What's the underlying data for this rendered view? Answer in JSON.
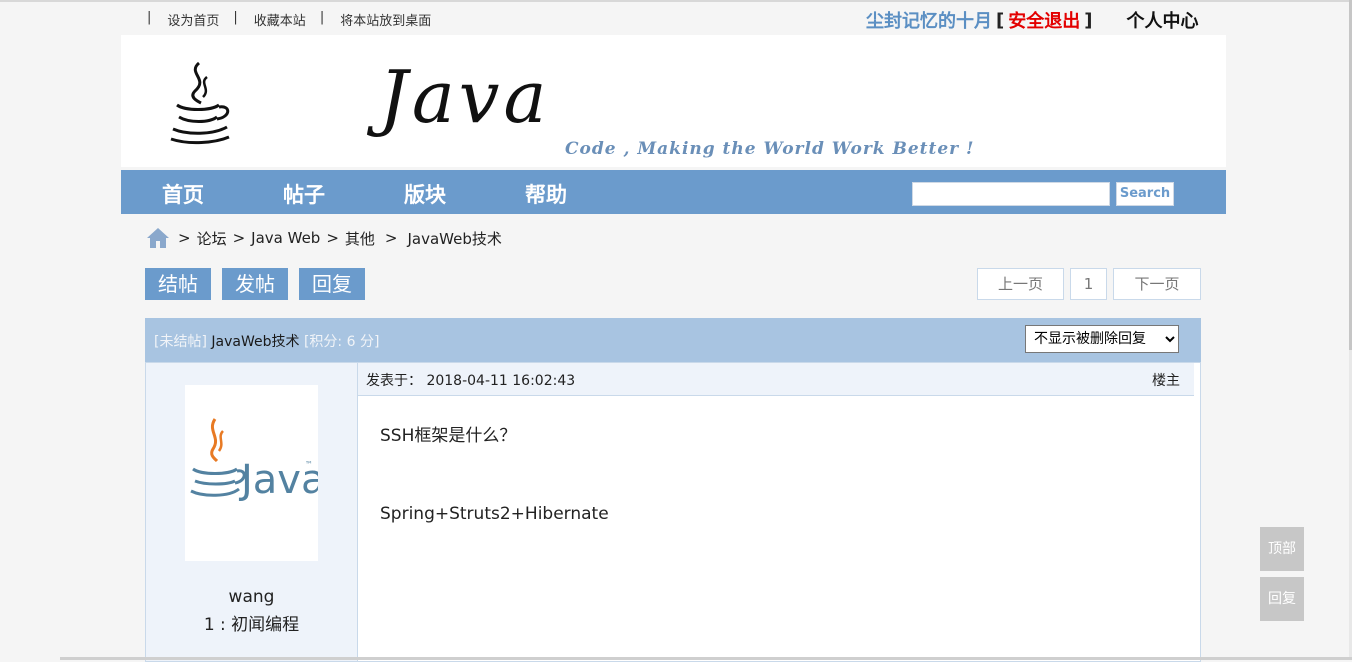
{
  "toplinks": [
    "设为首页",
    "收藏本站",
    "将本站放到桌面"
  ],
  "toplinks_sep": "|",
  "user": {
    "name": "尘封记忆的十月",
    "open": "[",
    "logout": "安全退出",
    "close": "]",
    "center": "个人中心"
  },
  "banner": {
    "brand": "Java",
    "slogan": "Code , Making the World Work Better !"
  },
  "nav": {
    "items": [
      "首页",
      "帖子",
      "版块",
      "帮助"
    ],
    "search_placeholder": "",
    "search_label": "Search"
  },
  "breadcrumb": [
    ">",
    "论坛",
    ">",
    "Java Web",
    ">",
    "其他",
    ">",
    "JavaWeb技术"
  ],
  "actions": {
    "close_post": "结帖",
    "new_post": "发帖",
    "reply": "回复"
  },
  "pager": {
    "prev": "上一页",
    "page": "1",
    "next": "下一页"
  },
  "thread": {
    "status_tag": "[未结帖]",
    "title": "JavaWeb技术",
    "score_tag": "[积分: 6 分]",
    "filter_selected": "不显示被删除回复"
  },
  "post": {
    "posted_label": "发表于：",
    "posted_time": "2018-04-11 16:02:43",
    "floor": "楼主",
    "lines": [
      "SSH框架是什么？",
      "Spring+Struts2+Hibernate"
    ]
  },
  "author": {
    "name": "wang",
    "level": "1 : 初闻编程",
    "avatar_text": "Java",
    "avatar_tm": "™"
  },
  "float": {
    "top": "顶部",
    "reply": "回复"
  },
  "colors": {
    "nav": "#6b9bcc",
    "thread_head": "#a8c4e1",
    "logout": "#e30000",
    "username": "#5b8fc3",
    "java_orange": "#e87a24",
    "java_blue": "#5382a1"
  }
}
